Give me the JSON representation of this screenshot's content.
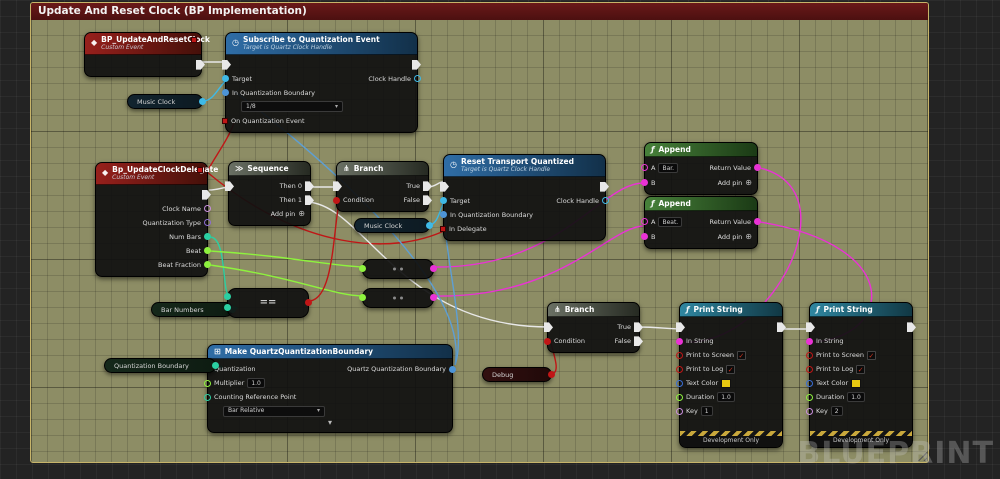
{
  "comment": {
    "title": "Update And Reset Clock (BP Implementation)"
  },
  "watermark": "BLUEPRINT",
  "icons": {
    "event": "◆",
    "fn": "ƒ",
    "clock": "◷",
    "make": "⊞",
    "sequence": "≫",
    "branch": "⋔",
    "add_pin": "⊕",
    "dropdown": "▾",
    "check": "✓",
    "expand": "▾"
  },
  "nodes": {
    "update_reset_event": {
      "title": "BP_UpdateAndResetClock",
      "subtitle": "Custom Event"
    },
    "subscribe": {
      "title": "Subscribe to Quantization Event",
      "subtitle": "Target is Quartz Clock Handle",
      "target": "Target",
      "in_quantization_boundary": "In Quantization Boundary",
      "boundary_value": "1/8",
      "on_quantization_event": "On Quantization Event",
      "clock_handle": "Clock Handle"
    },
    "music_clock_1": {
      "label": "Music Clock"
    },
    "update_clock_delegate": {
      "title": "Bp_UpdateClockDelegate",
      "subtitle": "Custom Event",
      "clock_name": "Clock Name",
      "quantization_type": "Quantization Type",
      "num_bars": "Num Bars",
      "beat": "Beat",
      "beat_fraction": "Beat Fraction"
    },
    "sequence": {
      "title": "Sequence",
      "then_0": "Then 0",
      "then_1": "Then 1",
      "add_pin": "Add pin"
    },
    "branch_1": {
      "title": "Branch",
      "condition": "Condition",
      "true_label": "True",
      "false_label": "False"
    },
    "music_clock_2": {
      "label": "Music Clock"
    },
    "reset_transport": {
      "title": "Reset Transport Quantized",
      "subtitle": "Target is Quartz Clock Handle",
      "target": "Target",
      "in_quantization_boundary": "In Quantization Boundary",
      "in_delegate": "In Delegate",
      "clock_handle": "Clock Handle"
    },
    "append_1": {
      "title": "Append",
      "a": "A",
      "a_value": "Bar.",
      "b": "B",
      "return_value": "Return Value",
      "add_pin": "Add pin"
    },
    "append_2": {
      "title": "Append",
      "a": "A",
      "a_value": "Beat.",
      "b": "B",
      "return_value": "Return Value",
      "add_pin": "Add pin"
    },
    "bar_numbers": {
      "label": "Bar Numbers"
    },
    "equals": {
      "operator": "=="
    },
    "branch_2": {
      "title": "Branch",
      "condition": "Condition",
      "true_label": "True",
      "false_label": "False"
    },
    "make_boundary": {
      "title": "Make QuartzQuantizationBoundary",
      "quantization": "Quantization",
      "multiplier": "Multiplier",
      "multiplier_value": "1.0",
      "counting_reference_point": "Counting Reference Point",
      "counting_value": "Bar Relative",
      "output": "Quartz Quantization Boundary"
    },
    "quantization_boundary": {
      "label": "Quantization Boundary"
    },
    "debug": {
      "label": "Debug"
    },
    "print_string_1": {
      "title": "Print String",
      "in_string": "In String",
      "print_to_screen": "Print to Screen",
      "print_to_log": "Print to Log",
      "text_color": "Text Color",
      "duration": "Duration",
      "duration_value": "1.0",
      "key": "Key",
      "key_value": "1",
      "footer": "Development Only"
    },
    "print_string_2": {
      "title": "Print String",
      "in_string": "In String",
      "print_to_screen": "Print to Screen",
      "print_to_log": "Print to Log",
      "text_color": "Text Color",
      "duration": "Duration",
      "duration_value": "1.0",
      "key": "Key",
      "key_value": "2",
      "footer": "Development Only"
    }
  }
}
